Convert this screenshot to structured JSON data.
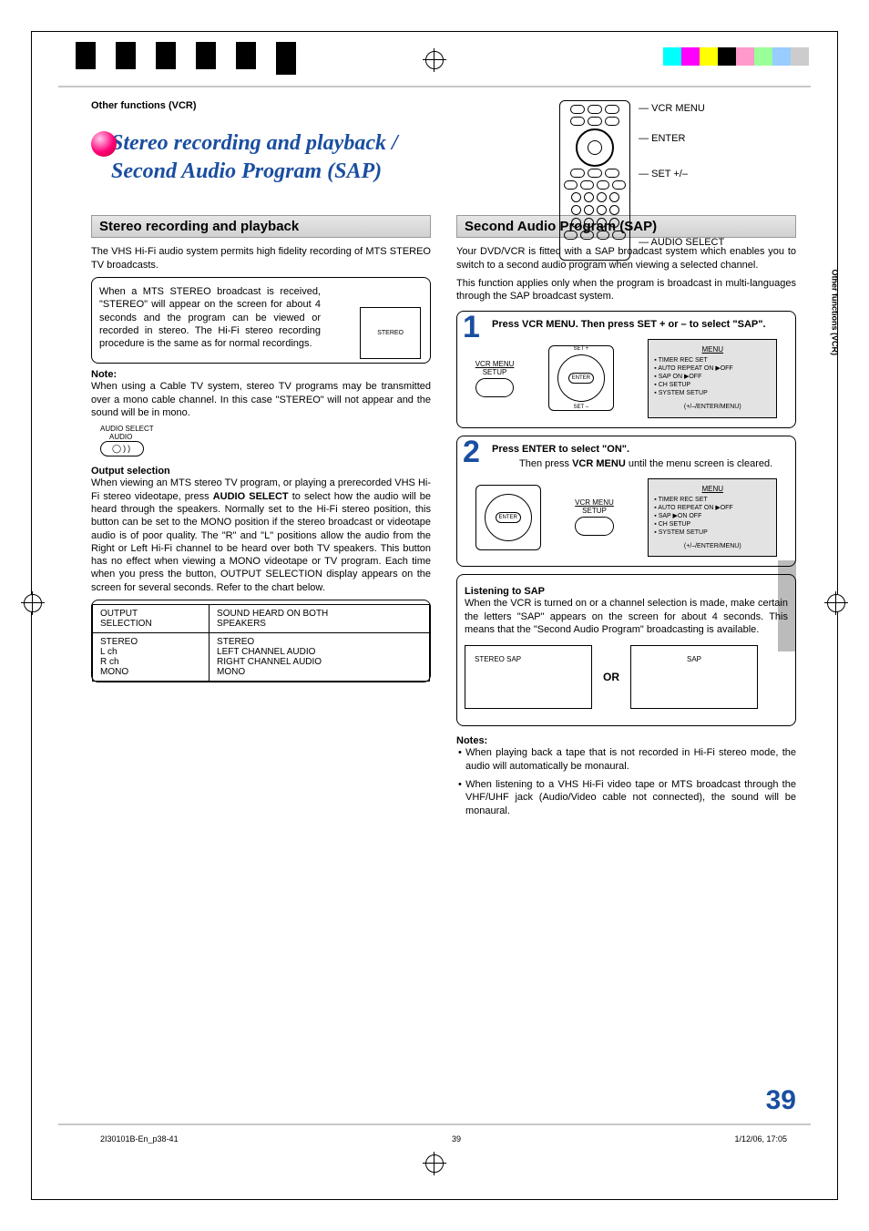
{
  "header": {
    "breadcrumb": "Other functions (VCR)"
  },
  "title": {
    "line1": "Stereo recording and playback /",
    "line2": "Second Audio Program (SAP)"
  },
  "remote": {
    "l1": "VCR MENU",
    "l2": "ENTER",
    "l3": "SET +/–",
    "l4": "AUDIO SELECT"
  },
  "side_tab": "Other functions (VCR)",
  "left": {
    "section": "Stereo recording and playback",
    "intro": "The VHS Hi-Fi audio system permits high fidelity recording of MTS STEREO TV broadcasts.",
    "box": "When a MTS STEREO broadcast is received, \"STEREO\" will appear on the screen for about 4 seconds and the program can be viewed or recorded in stereo. The Hi-Fi stereo recording procedure is the same as for normal recordings.",
    "stereo_label": "STEREO",
    "note_h": "Note:",
    "note": "When using a Cable TV system, stereo TV programs may be transmitted over a mono cable channel. In this case \"STEREO\" will not appear and the sound will be in mono.",
    "audio_select_label": "AUDIO SELECT",
    "audio_word": "AUDIO",
    "audio_glyph": "◯))",
    "out_h": "Output selection",
    "out_body_a": "When viewing an MTS stereo TV program, or playing a prerecorded VHS Hi-Fi stereo videotape, press ",
    "out_body_b": "AUDIO SELECT",
    "out_body_c": " to select how the audio will be heard through the speakers. Normally set to the Hi-Fi stereo position, this button can be set to the MONO position if the stereo broadcast or videotape audio is of poor quality. The \"R\" and \"L\" positions allow the audio from the Right or Left Hi-Fi channel to be heard over both TV speakers. This button has no effect when viewing a MONO videotape or TV program. Each time when you press the button, OUTPUT SELECTION display appears on the screen for several seconds. Refer to the chart below.",
    "table": {
      "h1a": "OUTPUT",
      "h1b": "SELECTION",
      "h2a": "SOUND HEARD ON BOTH",
      "h2b": "SPEAKERS",
      "r1": "STEREO",
      "r2": "L ch",
      "r3": "R ch",
      "r4": "MONO",
      "v1": "STEREO",
      "v2": "LEFT CHANNEL AUDIO",
      "v3": "RIGHT CHANNEL AUDIO",
      "v4": "MONO"
    }
  },
  "right": {
    "section": "Second Audio Program (SAP)",
    "intro1": "Your DVD/VCR is fitted with a SAP broadcast system which enables you to switch to a second audio program when viewing a selected channel.",
    "intro2": "This function applies only when the program is broadcast in multi-languages through the SAP broadcast system.",
    "step1": {
      "num": "1",
      "text": "Press VCR MENU. Then press SET + or – to select \"SAP\".",
      "vcr_menu": "VCR MENU",
      "setup": "SETUP",
      "enter": "ENTER",
      "setp": "SET +",
      "setm": "SET –",
      "menu_title": "MENU",
      "m1": "TIMER REC SET",
      "m2": "AUTO REPEAT     ON ▶OFF",
      "m3": "SAP                     ON ▶OFF",
      "m4": "CH SETUP",
      "m5": "SYSTEM SETUP",
      "mfoot": "(+/–/ENTER/MENU)"
    },
    "step2": {
      "num": "2",
      "text": "Press ENTER to select \"ON\".",
      "sub_a": "Then press ",
      "sub_b": "VCR MENU",
      "sub_c": " until the menu screen is cleared.",
      "menu_title": "MENU",
      "m1": "TIMER REC SET",
      "m2": "AUTO REPEAT     ON ▶OFF",
      "m3": "SAP                   ▶ON   OFF",
      "m4": "CH SETUP",
      "m5": "SYSTEM SETUP",
      "mfoot": "(+/–/ENTER/MENU)"
    },
    "listen": {
      "h": "Listening to SAP",
      "body": "When the VCR is turned on or a channel selection is made, make certain the letters \"SAP\" appears on the screen for about 4 seconds. This means that the \"Second Audio Program\" broadcasting is available.",
      "b1": "STEREO  SAP",
      "or": "OR",
      "b2": "SAP"
    },
    "notes_h": "Notes:",
    "note1": "When playing back a tape that is not recorded in Hi-Fi stereo mode, the audio will automatically be monaural.",
    "note2": "When listening to a VHS Hi-Fi video tape or MTS broadcast through the VHF/UHF jack (Audio/Video cable not connected), the sound will be monaural."
  },
  "page_number": "39",
  "footer": {
    "left": "2I30101B-En_p38-41",
    "mid": "39",
    "right": "1/12/06, 17:05"
  }
}
